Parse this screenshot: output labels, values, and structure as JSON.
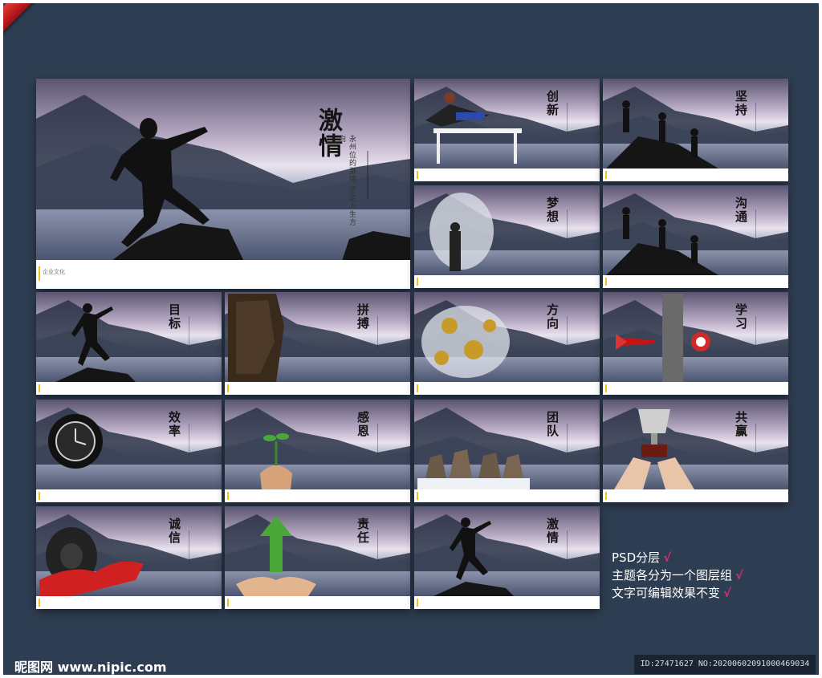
{
  "cards": [
    {
      "title": "激情",
      "subtitle": "永州位的激情 坚定人生方向",
      "footer": "企业文化",
      "big": true
    },
    {
      "title": "创新"
    },
    {
      "title": "坚持"
    },
    {
      "title": "梦想"
    },
    {
      "title": "沟通"
    },
    {
      "title": "目标"
    },
    {
      "title": "拼搏"
    },
    {
      "title": "方向"
    },
    {
      "title": "学习"
    },
    {
      "title": "效率"
    },
    {
      "title": "感恩"
    },
    {
      "title": "团队"
    },
    {
      "title": "共赢"
    },
    {
      "title": "诚信"
    },
    {
      "title": "责任"
    },
    {
      "title": "激情"
    }
  ],
  "notes": {
    "line1": "PSD分层",
    "line2": "主题各分为一个图层组",
    "line3": "文字可编辑效果不变",
    "check": "√"
  },
  "watermark": {
    "logo": "昵图网 www.nipic.com",
    "id": "ID:27471627 NO:20200602091000469034"
  }
}
